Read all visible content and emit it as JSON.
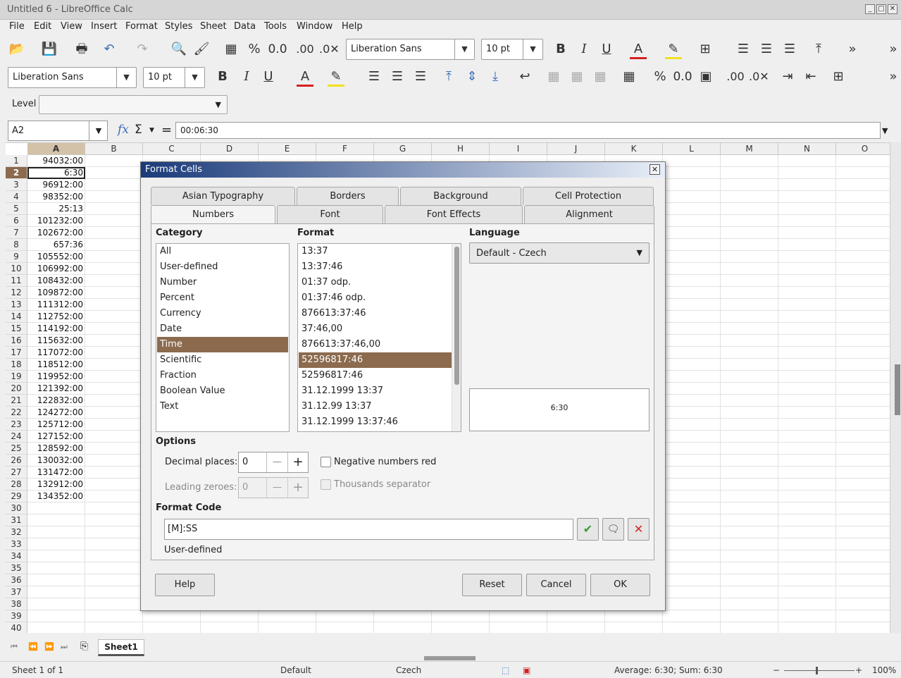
{
  "window": {
    "title": "Untitled 6 - LibreOffice Calc"
  },
  "menu": [
    "File",
    "Edit",
    "View",
    "Insert",
    "Format",
    "Styles",
    "Sheet",
    "Data",
    "Tools",
    "Window",
    "Help"
  ],
  "toolbar1": {
    "font_name": "Liberation Sans",
    "font_size": "10 pt"
  },
  "toolbar2": {
    "font_name": "Liberation Sans",
    "font_size": "10 pt"
  },
  "level": {
    "label": "Level"
  },
  "formula_bar": {
    "cell_ref": "A2",
    "content": "00:06:30"
  },
  "columns": [
    "A",
    "B",
    "C",
    "D",
    "E",
    "F",
    "G",
    "H",
    "I",
    "J",
    "K",
    "L",
    "M",
    "N",
    "O"
  ],
  "rows": [
    "1",
    "2",
    "3",
    "4",
    "5",
    "6",
    "7",
    "8",
    "9",
    "10",
    "11",
    "12",
    "13",
    "14",
    "15",
    "16",
    "17",
    "18",
    "19",
    "20",
    "21",
    "22",
    "23",
    "24",
    "25",
    "26",
    "27",
    "28",
    "29",
    "30",
    "31",
    "32",
    "33",
    "34",
    "35",
    "36",
    "37",
    "38",
    "39",
    "40"
  ],
  "col_a_values": [
    "94032:00",
    "6:30",
    "96912:00",
    "98352:00",
    "25:13",
    "101232:00",
    "102672:00",
    "657:36",
    "105552:00",
    "106992:00",
    "108432:00",
    "109872:00",
    "111312:00",
    "112752:00",
    "114192:00",
    "115632:00",
    "117072:00",
    "118512:00",
    "119952:00",
    "121392:00",
    "122832:00",
    "124272:00",
    "125712:00",
    "127152:00",
    "128592:00",
    "130032:00",
    "131472:00",
    "132912:00",
    "134352:00"
  ],
  "dialog": {
    "title": "Format Cells",
    "tabs_row1": [
      "Asian Typography",
      "Borders",
      "Background",
      "Cell Protection"
    ],
    "tabs_row2": [
      "Numbers",
      "Font",
      "Font Effects",
      "Alignment"
    ],
    "category_label": "Category",
    "format_label": "Format",
    "language_label": "Language",
    "categories": [
      "All",
      "User-defined",
      "Number",
      "Percent",
      "Currency",
      "Date",
      "Time",
      "Scientific",
      "Fraction",
      "Boolean Value",
      "Text"
    ],
    "selected_category": "Time",
    "formats": [
      "13:37",
      "13:37:46",
      "01:37 odp.",
      "01:37:46 odp.",
      "876613:37:46",
      "37:46,00",
      "876613:37:46,00",
      "52596817:46",
      "52596817:46",
      "31.12.1999 13:37",
      "31.12.99 13:37",
      "31.12.1999 13:37:46"
    ],
    "language_value": "Default - Czech",
    "preview": "6:30",
    "options_label": "Options",
    "decimal_places_label": "Decimal places:",
    "decimal_places_value": "0",
    "leading_zeroes_label": "Leading zeroes:",
    "leading_zeroes_value": "0",
    "negative_red_label": "Negative numbers red",
    "thousands_label": "Thousands separator",
    "format_code_label": "Format Code",
    "format_code_value": "[M]:SS",
    "format_code_desc": "User-defined",
    "buttons": {
      "help": "Help",
      "reset": "Reset",
      "cancel": "Cancel",
      "ok": "OK"
    }
  },
  "sheet_tab": "Sheet1",
  "status": {
    "sheet": "Sheet 1 of 1",
    "style": "Default",
    "language": "Czech",
    "summary": "Average: 6:30; Sum: 6:30",
    "zoom": "100%"
  },
  "colors": {
    "selection": "#8b6a4e",
    "titlebar_start": "#1a3a7a",
    "error_red": "#d42020",
    "ok_green": "#3a9a3a"
  }
}
